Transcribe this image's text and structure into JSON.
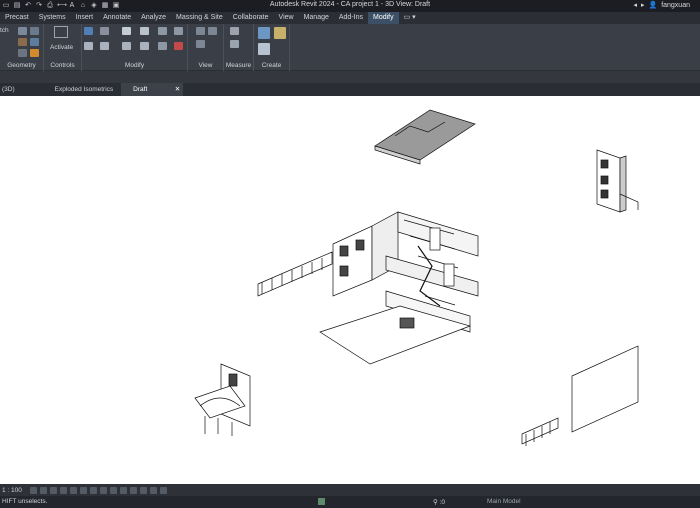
{
  "window": {
    "title": "Autodesk Revit 2024 - CA project 1 - 3D View: Draft",
    "user": "fangxuan"
  },
  "menu_tabs": [
    "Precast",
    "Systems",
    "Insert",
    "Annotate",
    "Analyze",
    "Massing & Site",
    "Collaborate",
    "View",
    "Manage",
    "Add-Ins",
    "Modify"
  ],
  "active_tab": "Modify",
  "ribbon": {
    "panels": [
      "Geometry",
      "Controls",
      "Modify",
      "View",
      "Measure",
      "Create"
    ],
    "activate_label": "Activate",
    "left_partial": "tch"
  },
  "view_tabs": [
    {
      "label": "(3D)"
    },
    {
      "label": "Exploded Isometrics"
    },
    {
      "label": "Draft",
      "close": "✕"
    }
  ],
  "status": {
    "scale": "1 : 100",
    "message": "HIFT unselects.",
    "worksets": ":0",
    "model": "Main Model"
  },
  "colors": {
    "accent": "#3b4f66",
    "chrome": "#2b2e35",
    "ribbon": "#3a3e46"
  }
}
